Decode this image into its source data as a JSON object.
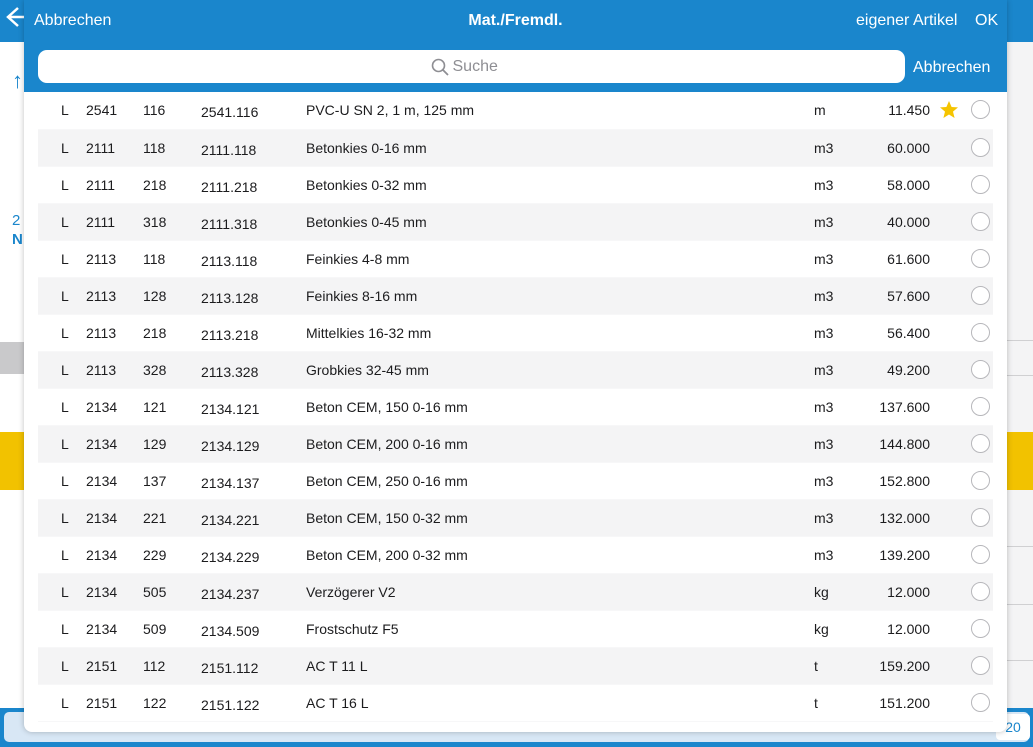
{
  "background": {
    "bottom_number": "20",
    "left_text_top": "2",
    "left_text_bottom": "N"
  },
  "header": {
    "cancel_label": "Abbrechen",
    "title": "Mat./Fremdl.",
    "own_article_label": "eigener Artikel",
    "ok_label": "OK"
  },
  "search": {
    "placeholder": "Suche",
    "cancel_label": "Abbrechen",
    "icon": "search-icon"
  },
  "colors": {
    "accent": "#1a86cc",
    "star": "#f5c400",
    "highlight": "#f2c200"
  },
  "rows": [
    {
      "type": "L",
      "group": "2541",
      "sub": "116",
      "number": "2541.116",
      "desc": "PVC-U SN 2, 1 m, 125 mm",
      "unit": "m",
      "price": "11.450",
      "favorite": true
    },
    {
      "type": "L",
      "group": "2111",
      "sub": "118",
      "number": "2111.118",
      "desc": "Betonkies 0-16 mm",
      "unit": "m3",
      "price": "60.000",
      "favorite": false
    },
    {
      "type": "L",
      "group": "2111",
      "sub": "218",
      "number": "2111.218",
      "desc": "Betonkies 0-32 mm",
      "unit": "m3",
      "price": "58.000",
      "favorite": false
    },
    {
      "type": "L",
      "group": "2111",
      "sub": "318",
      "number": "2111.318",
      "desc": "Betonkies 0-45 mm",
      "unit": "m3",
      "price": "40.000",
      "favorite": false
    },
    {
      "type": "L",
      "group": "2113",
      "sub": "118",
      "number": "2113.118",
      "desc": "Feinkies 4-8 mm",
      "unit": "m3",
      "price": "61.600",
      "favorite": false
    },
    {
      "type": "L",
      "group": "2113",
      "sub": "128",
      "number": "2113.128",
      "desc": "Feinkies 8-16 mm",
      "unit": "m3",
      "price": "57.600",
      "favorite": false
    },
    {
      "type": "L",
      "group": "2113",
      "sub": "218",
      "number": "2113.218",
      "desc": "Mittelkies 16-32 mm",
      "unit": "m3",
      "price": "56.400",
      "favorite": false
    },
    {
      "type": "L",
      "group": "2113",
      "sub": "328",
      "number": "2113.328",
      "desc": "Grobkies 32-45 mm",
      "unit": "m3",
      "price": "49.200",
      "favorite": false
    },
    {
      "type": "L",
      "group": "2134",
      "sub": "121",
      "number": "2134.121",
      "desc": "Beton CEM, 150 0-16 mm",
      "unit": "m3",
      "price": "137.600",
      "favorite": false
    },
    {
      "type": "L",
      "group": "2134",
      "sub": "129",
      "number": "2134.129",
      "desc": "Beton CEM, 200 0-16 mm",
      "unit": "m3",
      "price": "144.800",
      "favorite": false
    },
    {
      "type": "L",
      "group": "2134",
      "sub": "137",
      "number": "2134.137",
      "desc": "Beton CEM, 250 0-16 mm",
      "unit": "m3",
      "price": "152.800",
      "favorite": false
    },
    {
      "type": "L",
      "group": "2134",
      "sub": "221",
      "number": "2134.221",
      "desc": "Beton CEM, 150 0-32 mm",
      "unit": "m3",
      "price": "132.000",
      "favorite": false
    },
    {
      "type": "L",
      "group": "2134",
      "sub": "229",
      "number": "2134.229",
      "desc": "Beton CEM, 200 0-32 mm",
      "unit": "m3",
      "price": "139.200",
      "favorite": false
    },
    {
      "type": "L",
      "group": "2134",
      "sub": "505",
      "number": "2134.237",
      "desc": "Verzögerer V2",
      "unit": "kg",
      "price": "12.000",
      "favorite": false
    },
    {
      "type": "L",
      "group": "2134",
      "sub": "509",
      "number": "2134.509",
      "desc": "Frostschutz F5",
      "unit": "kg",
      "price": "12.000",
      "favorite": false
    },
    {
      "type": "L",
      "group": "2151",
      "sub": "112",
      "number": "2151.112",
      "desc": "AC T 11 L",
      "unit": "t",
      "price": "159.200",
      "favorite": false
    },
    {
      "type": "L",
      "group": "2151",
      "sub": "122",
      "number": "2151.122",
      "desc": "AC T 16 L",
      "unit": "t",
      "price": "151.200",
      "favorite": false
    }
  ]
}
